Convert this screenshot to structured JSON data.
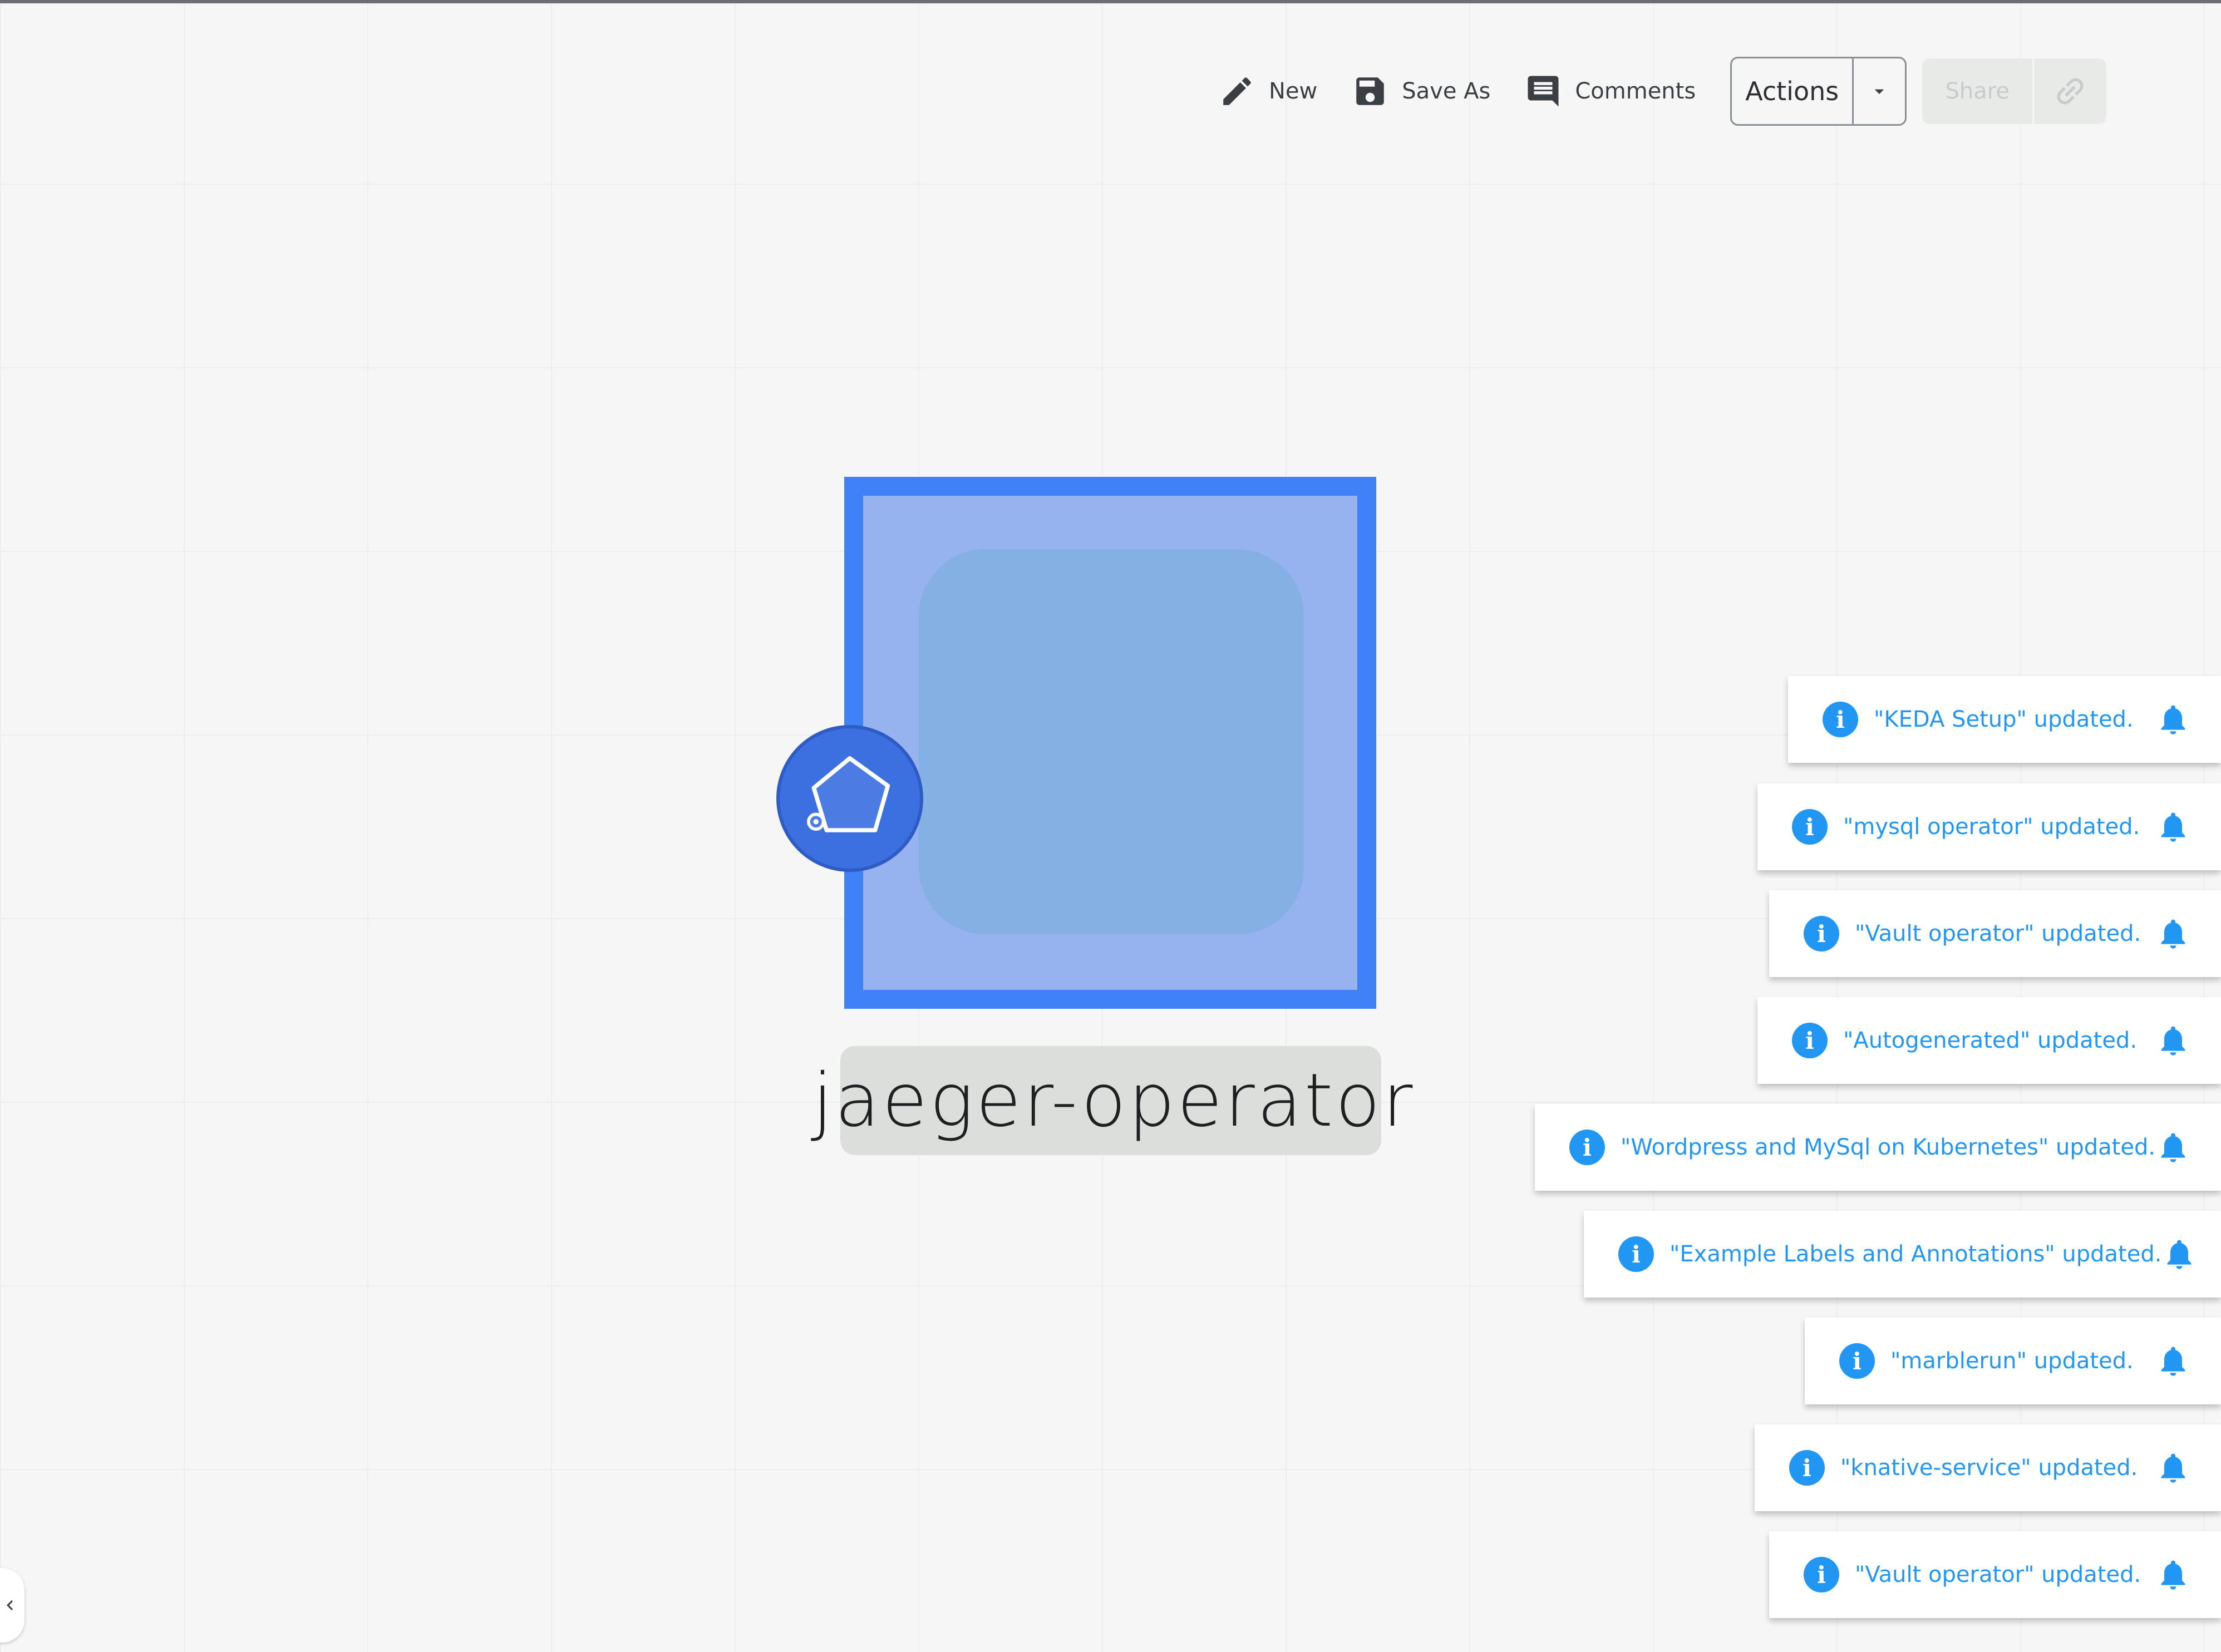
{
  "toolbar": {
    "new_label": "New",
    "save_as_label": "Save As",
    "comments_label": "Comments",
    "actions_label": "Actions",
    "share_label": "Share",
    "icons": [
      "pencil-icon",
      "floppy-disk-icon",
      "comment-icon",
      "caret-down-icon",
      "link-icon"
    ]
  },
  "canvas": {
    "node": {
      "label": "jaeger-operator",
      "badge_icon": "pentagon-shape-icon"
    }
  },
  "notifications": [
    {
      "message": "\"KEDA Setup\" updated."
    },
    {
      "message": "\"mysql operator\" updated."
    },
    {
      "message": "\"Vault operator\" updated."
    },
    {
      "message": "\"Autogenerated\" updated."
    },
    {
      "message": "\"Wordpress and MySql on Kubernetes\" updated."
    },
    {
      "message": "\"Example Labels and Annotations\" updated."
    },
    {
      "message": "\"marblerun\" updated."
    },
    {
      "message": "\"knative-service\" updated."
    },
    {
      "message": "\"Vault operator\" updated."
    }
  ],
  "notification_icon": "info-icon",
  "notification_action_icon": "bell-icon",
  "colors": {
    "accent": "#3f82f7",
    "notification_text": "#2196f3",
    "node_fill": "#96b2ef",
    "badge": "#3c6fdf"
  }
}
